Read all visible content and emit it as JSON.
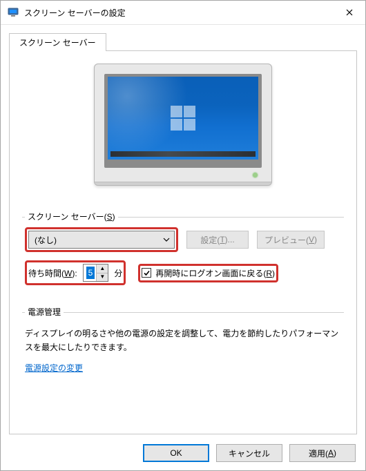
{
  "titlebar": {
    "title": "スクリーン セーバーの設定"
  },
  "tab": {
    "label": "スクリーン セーバー"
  },
  "screensaver": {
    "section_label_pre": "スクリーン セーバー(",
    "section_label_hotkey": "S",
    "section_label_post": ")",
    "selected": "(なし)",
    "settings_btn_pre": "設定(",
    "settings_btn_hotkey": "T",
    "settings_btn_post": ")...",
    "preview_btn_pre": "プレビュー(",
    "preview_btn_hotkey": "V",
    "preview_btn_post": ")",
    "wait_label_pre": "待ち時間(",
    "wait_label_hotkey": "W",
    "wait_label_post": "):",
    "wait_value": "5",
    "wait_unit": "分",
    "logon_label_pre": "再開時にログオン画面に戻る(",
    "logon_label_hotkey": "R",
    "logon_label_post": ")",
    "logon_checked": true
  },
  "power": {
    "section_label": "電源管理",
    "text": "ディスプレイの明るさや他の電源の設定を調整して、電力を節約したりパフォーマンスを最大にしたりできます。",
    "link": "電源設定の変更"
  },
  "buttons": {
    "ok": "OK",
    "cancel": "キャンセル",
    "apply_pre": "適用(",
    "apply_hotkey": "A",
    "apply_post": ")"
  }
}
